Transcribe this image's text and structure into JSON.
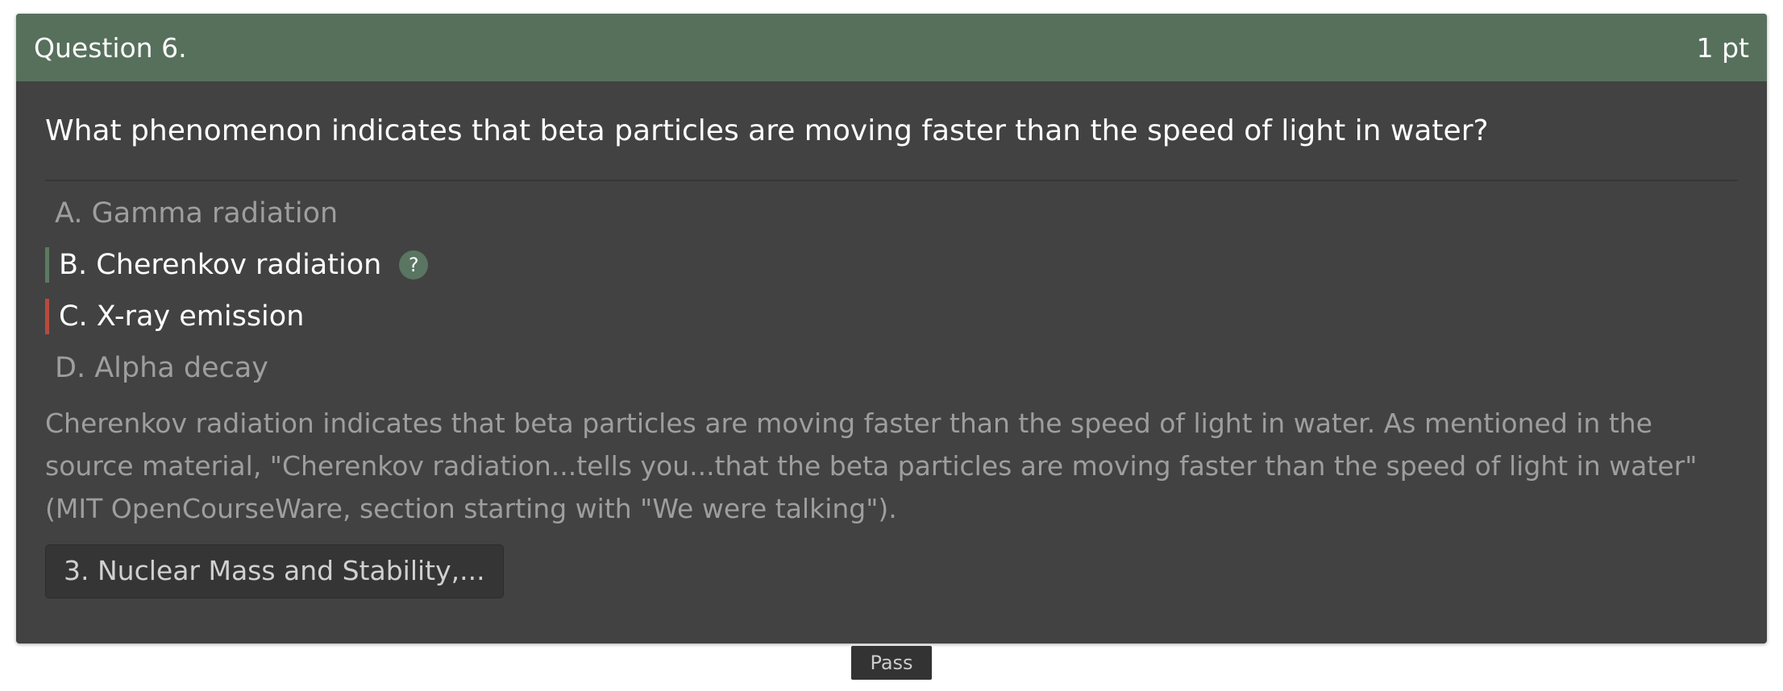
{
  "header": {
    "question_label": "Question 6.",
    "points": "1 pt"
  },
  "question": {
    "text": "What phenomenon indicates that beta particles are moving faster than the speed of light in water?"
  },
  "options": [
    {
      "label": "A. Gamma radiation",
      "state": "neutral"
    },
    {
      "label": "B. Cherenkov radiation",
      "state": "correct",
      "badge": "?"
    },
    {
      "label": "C. X-ray emission",
      "state": "incorrect"
    },
    {
      "label": "D. Alpha decay",
      "state": "neutral"
    }
  ],
  "explanation": "Cherenkov radiation indicates that beta particles are moving faster than the speed of light in water. As mentioned in the source material, \"Cherenkov radiation...tells you...that the beta particles are moving faster than the speed of light in water\" (MIT OpenCourseWare, section starting with \"We were talking\").",
  "source": {
    "label": "3. Nuclear Mass and Stability,..."
  },
  "pass_button": {
    "label": "Pass"
  },
  "colors": {
    "header": "#57705c",
    "card": "#424242",
    "correct_bar": "#5c7a63",
    "incorrect_bar": "#b84a3e"
  }
}
